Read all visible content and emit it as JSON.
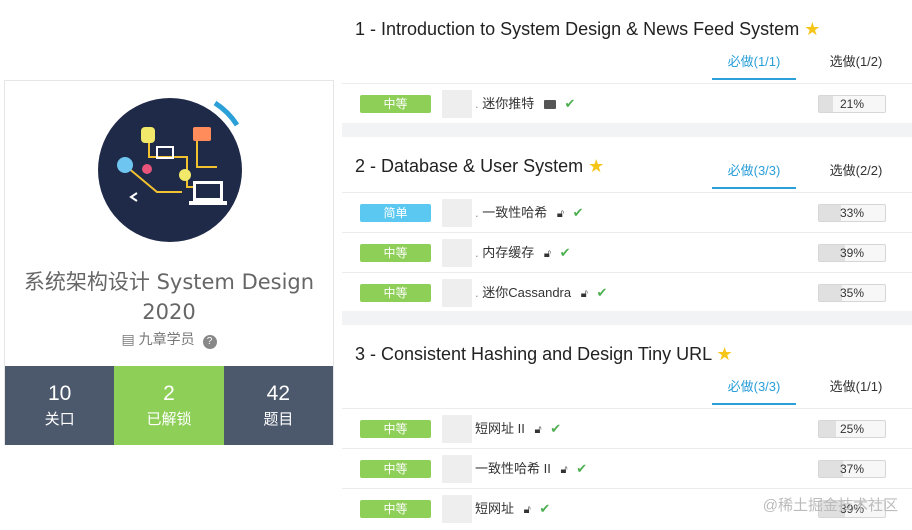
{
  "card": {
    "title": "系统架构设计 System Design 2020",
    "org": "九章学员",
    "stats": [
      {
        "num": "10",
        "label": "关口"
      },
      {
        "num": "2",
        "label": "已解锁"
      },
      {
        "num": "42",
        "label": "题目"
      }
    ]
  },
  "sections": [
    {
      "title": "1 - Introduction to System Design & News Feed System",
      "tab_required": "必做(1/1)",
      "tab_optional": "选做(1/2)",
      "rows": [
        {
          "level": "中等",
          "name": "迷你推特",
          "extra_icon": "briefcase-icon",
          "progress": "21%",
          "fill": 21
        }
      ]
    },
    {
      "title": "2 - Database & User System",
      "tab_required": "必做(3/3)",
      "tab_optional": "选做(2/2)",
      "rows": [
        {
          "level": "简单",
          "name": "一致性哈希",
          "extra_icon": "lock-icon",
          "progress": "33%",
          "fill": 33
        },
        {
          "level": "中等",
          "name": "内存缓存",
          "extra_icon": "lock-icon",
          "progress": "39%",
          "fill": 39
        },
        {
          "level": "中等",
          "name": "迷你Cassandra",
          "extra_icon": "lock-icon",
          "progress": "35%",
          "fill": 35
        }
      ]
    },
    {
      "title": "3 - Consistent Hashing and Design Tiny URL",
      "tab_required": "必做(3/3)",
      "tab_optional": "选做(1/1)",
      "rows": [
        {
          "level": "中等",
          "name": "短网址 II",
          "extra_icon": "lock-icon",
          "progress": "25%",
          "fill": 25
        },
        {
          "level": "中等",
          "name": "一致性哈希 II",
          "extra_icon": "lock-icon",
          "progress": "37%",
          "fill": 37
        },
        {
          "level": "中等",
          "name": "短网址",
          "extra_icon": "lock-icon",
          "progress": "39%",
          "fill": 39
        }
      ]
    }
  ],
  "watermark": "@稀土掘金技术社区",
  "colors": {
    "green": "#8ecf57",
    "blue": "#5ac8f0",
    "accent": "#2b9fd8",
    "dark": "#4c586c"
  }
}
